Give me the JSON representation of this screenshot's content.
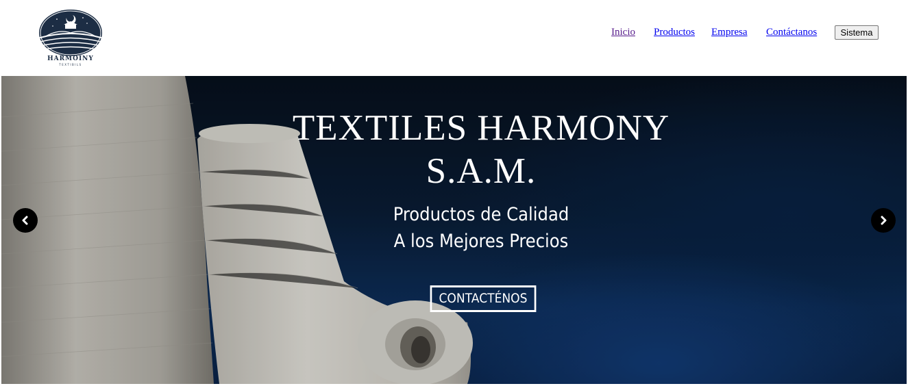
{
  "brand": {
    "logo_text": "HARMOINY",
    "logo_subtext": "TEXTIBILS",
    "colors": {
      "navy": "#1c2d44"
    }
  },
  "nav": {
    "items": [
      {
        "label": "Inicio",
        "state": "visited"
      },
      {
        "label": "Productos",
        "state": "link"
      },
      {
        "label": "Empresa",
        "state": "link"
      },
      {
        "label": "Contáctanos",
        "state": "link"
      }
    ],
    "system_button": "Sistema"
  },
  "hero": {
    "title_line1": "TEXTILES HARMONY",
    "title_line2": "S.A.M.",
    "subtitle_line1": "Productos de Calidad",
    "subtitle_line2": "A los Mejores Precios",
    "cta_label": "CONTACTÉNOS",
    "prev_icon": "chevron-left-icon",
    "next_icon": "chevron-right-icon"
  }
}
